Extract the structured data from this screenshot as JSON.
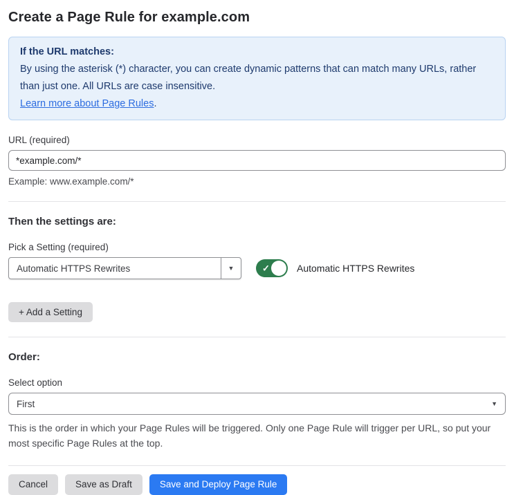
{
  "page": {
    "title": "Create a Page Rule for example.com"
  },
  "info_box": {
    "heading": "If the URL matches:",
    "body": "By using the asterisk (*) character, you can create dynamic patterns that can match many URLs, rather than just one. All URLs are case insensitive.",
    "link": "Learn more about Page Rules",
    "link_suffix": "."
  },
  "url_field": {
    "label": "URL (required)",
    "value": "*example.com/*",
    "helper": "Example: www.example.com/*"
  },
  "settings_section": {
    "heading": "Then the settings are:",
    "picker_label": "Pick a Setting (required)",
    "picker_value": "Automatic HTTPS Rewrites",
    "toggle_state": "on",
    "toggle_label": "Automatic HTTPS Rewrites",
    "add_setting_button": "+ Add a Setting"
  },
  "order_section": {
    "heading": "Order:",
    "select_label": "Select option",
    "select_value": "First",
    "helper": "This is the order in which your Page Rules will be triggered. Only one Page Rule will trigger per URL, so put your most specific Page Rules at the top."
  },
  "footer": {
    "cancel_label": "Cancel",
    "save_draft_label": "Save as Draft",
    "save_deploy_label": "Save and Deploy Page Rule"
  },
  "colors": {
    "accent_blue": "#2b7af2",
    "toggle_green": "#2d7d4d",
    "info_bg": "#e8f1fb",
    "info_border": "#b9d3f1",
    "info_text": "#1e3a6d",
    "link_blue": "#2c6ce0"
  },
  "icons": {
    "dropdown_arrow": "▼",
    "toggle_check": "✓"
  }
}
